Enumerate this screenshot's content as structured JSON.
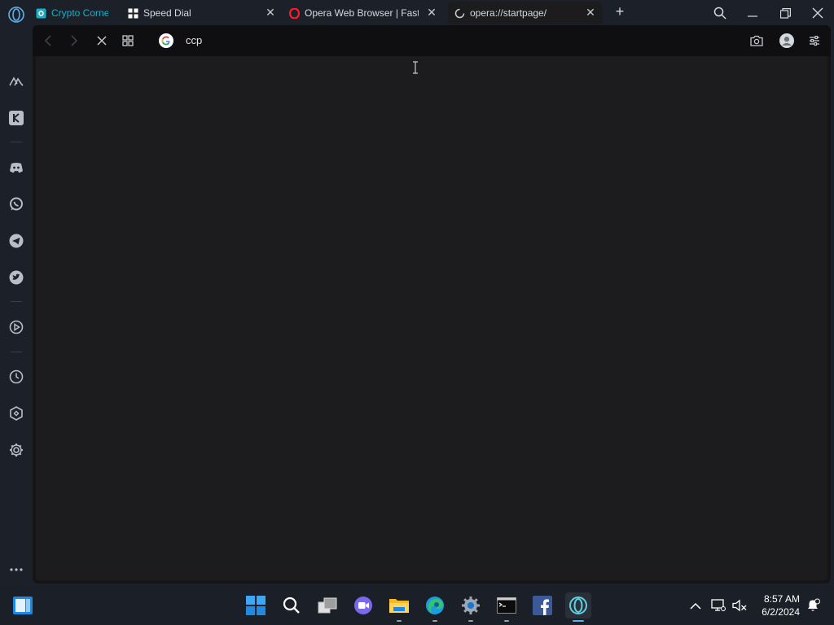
{
  "tabs": [
    {
      "label": "Crypto Corner",
      "favicon": "crypto-corner-icon",
      "color": "#16b0c9"
    },
    {
      "label": "Speed Dial",
      "favicon": "speed-dial-grid-icon",
      "color": "#ffffff"
    },
    {
      "label": "Opera Web Browser | Faster, Safer, Smarter",
      "favicon": "opera-o-icon",
      "color": "#ff1b2d"
    },
    {
      "label": "opera://startpage/",
      "favicon": "loading-spinner-icon",
      "active": true
    }
  ],
  "address_bar": {
    "value": "ccp",
    "search_engine": "google-icon"
  },
  "sidebar": {
    "items": [
      "aria-icon",
      "kucoin-icon",
      "discord-icon",
      "whatsapp-icon",
      "telegram-icon",
      "twitter-icon",
      "player-icon",
      "history-icon",
      "extensions-icon",
      "settings-icon",
      "more-icon"
    ]
  },
  "taskbar": {
    "apps": [
      "windows-start-icon",
      "search-icon",
      "task-view-icon",
      "teams-chat-icon",
      "file-explorer-icon",
      "edge-icon",
      "settings-icon",
      "terminal-icon",
      "facebook-icon",
      "opera-gx-icon"
    ],
    "time": "8:57 AM",
    "date": "6/2/2024"
  },
  "colors": {
    "accent": "#5fb0e8",
    "window_bg": "#1c2129",
    "content_bg": "#1c1c1e"
  }
}
